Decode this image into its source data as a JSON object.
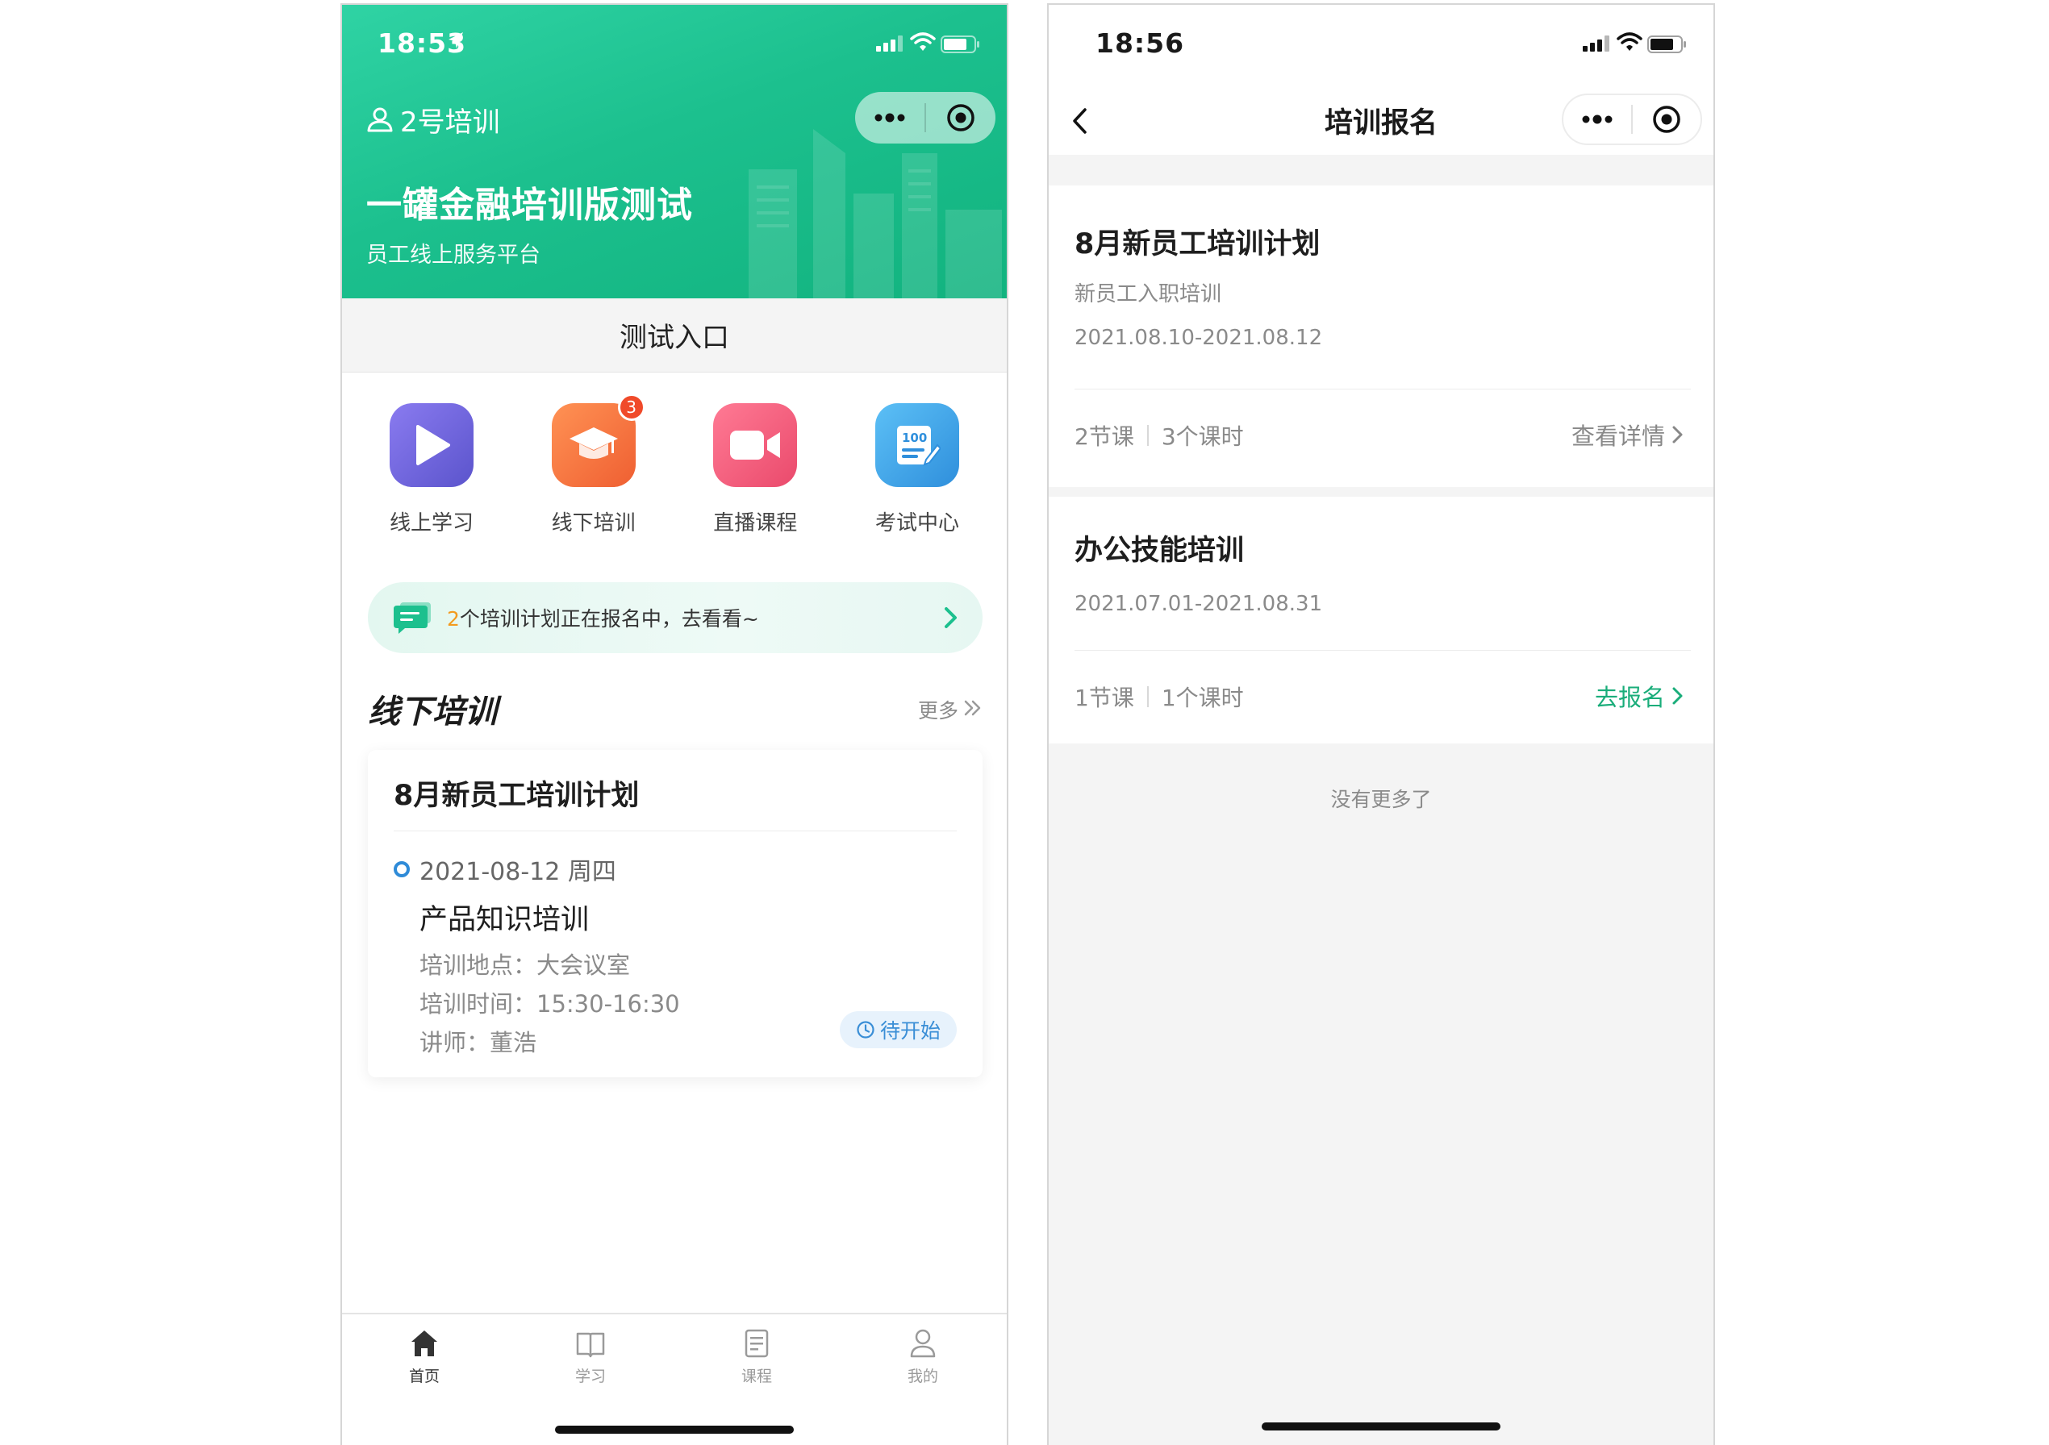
{
  "left": {
    "status_time": "18:53",
    "brand": "2号培训",
    "title": "一罐金融培训版测试",
    "subtitle": "员工线上服务平台",
    "entry_label": "测试入口",
    "grid": [
      {
        "label": "线上学习",
        "icon": "play-icon",
        "color": "#7067dc"
      },
      {
        "label": "线下培训",
        "icon": "graduation-cap-icon",
        "color": "#f57a43",
        "badge": "3"
      },
      {
        "label": "直播课程",
        "icon": "video-camera-icon",
        "color": "#f25f7b"
      },
      {
        "label": "考试中心",
        "icon": "exam-paper-icon",
        "color": "#3fa6e8"
      }
    ],
    "notice": {
      "count": "2",
      "text": "个培训计划正在报名中，去看看~"
    },
    "section": {
      "title": "线下培训",
      "more": "更多"
    },
    "card": {
      "title": "8月新员工培训计划",
      "date": "2021-08-12 周四",
      "course": "产品知识培训",
      "location": "培训地点：大会议室",
      "time": "培训时间：15:30-16:30",
      "teacher": "讲师：董浩",
      "status": "待开始"
    },
    "tabs": [
      {
        "label": "首页",
        "icon": "home-icon",
        "active": true
      },
      {
        "label": "学习",
        "icon": "book-icon",
        "active": false
      },
      {
        "label": "课程",
        "icon": "document-icon",
        "active": false
      },
      {
        "label": "我的",
        "icon": "user-icon",
        "active": false
      }
    ]
  },
  "right": {
    "status_time": "18:56",
    "nav_title": "培训报名",
    "items": [
      {
        "title": "8月新员工培训计划",
        "category": "新员工入职培训",
        "dates": "2021.08.10-2021.08.12",
        "lessons": "2节课",
        "hours": "3个课时",
        "action": "查看详情"
      },
      {
        "title": "办公技能培训",
        "dates": "2021.07.01-2021.08.31",
        "lessons": "1节课",
        "hours": "1个课时",
        "action": "去报名"
      }
    ],
    "no_more": "没有更多了"
  },
  "colors": {
    "brand_green": "#1cc08e",
    "action_green": "#1aad7a",
    "status_blue": "#3a8ed6",
    "notice_count": "#f39b1f"
  }
}
